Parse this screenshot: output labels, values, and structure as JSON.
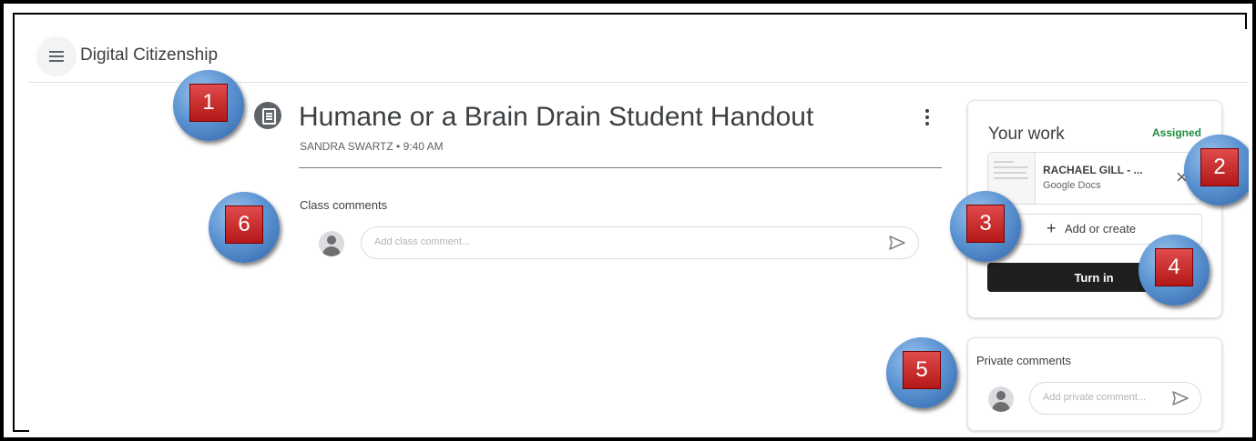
{
  "header": {
    "course_title": "Digital Citizenship",
    "menu_icon": "hamburger-menu-icon"
  },
  "assignment": {
    "title": "Humane or a Brain Drain Student Handout",
    "author": "SANDRA SWARTZ",
    "separator": "•",
    "time": "9:40 AM",
    "icon": "assignment-icon"
  },
  "class_comments": {
    "label": "Class comments",
    "placeholder": "Add class comment..."
  },
  "your_work": {
    "title": "Your work",
    "status": "Assigned",
    "attachment": {
      "name": "RACHAEL GILL - ...",
      "type": "Google Docs"
    },
    "add_label": "Add or create",
    "turn_in_label": "Turn in"
  },
  "private_comments": {
    "label": "Private comments",
    "placeholder": "Add private comment..."
  },
  "markers": [
    "1",
    "2",
    "3",
    "4",
    "5",
    "6"
  ],
  "colors": {
    "status_green": "#1e8e3e",
    "turn_in_bg": "#1f1f1f",
    "marker_red": "#c62828",
    "marker_blue": "#4a86c8"
  }
}
